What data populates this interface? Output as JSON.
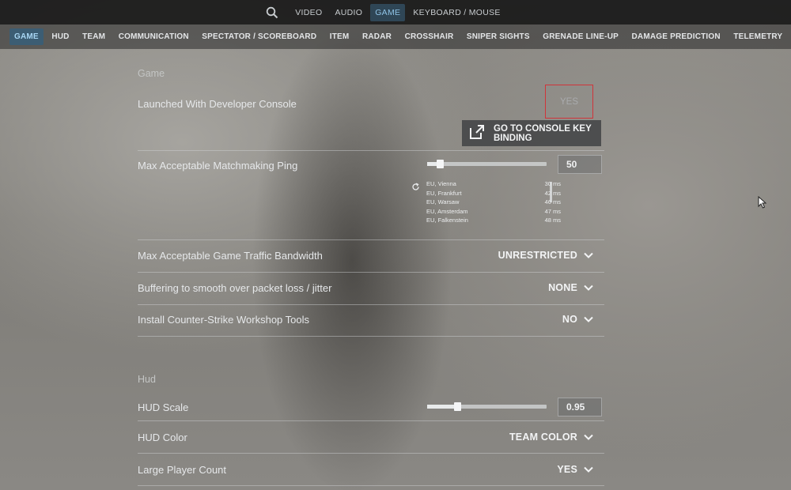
{
  "top_nav": {
    "tabs": [
      {
        "label": "VIDEO"
      },
      {
        "label": "AUDIO"
      },
      {
        "label": "GAME",
        "active": true
      },
      {
        "label": "KEYBOARD / MOUSE"
      }
    ]
  },
  "sub_nav": {
    "tabs": [
      {
        "label": "GAME",
        "active": true
      },
      {
        "label": "HUD"
      },
      {
        "label": "TEAM"
      },
      {
        "label": "COMMUNICATION"
      },
      {
        "label": "SPECTATOR / SCOREBOARD"
      },
      {
        "label": "ITEM"
      },
      {
        "label": "RADAR"
      },
      {
        "label": "CROSSHAIR"
      },
      {
        "label": "SNIPER SIGHTS"
      },
      {
        "label": "GRENADE LINE-UP"
      },
      {
        "label": "DAMAGE PREDICTION"
      },
      {
        "label": "TELEMETRY"
      }
    ]
  },
  "game_section": {
    "title": "Game",
    "dev_console": {
      "label": "Launched With Developer Console",
      "value": "YES",
      "button": "GO TO CONSOLE KEY BINDING"
    },
    "ping": {
      "label": "Max Acceptable Matchmaking Ping",
      "value": "50",
      "servers": [
        {
          "name": "EU, Vienna",
          "ping": "30 ms"
        },
        {
          "name": "EU, Frankfurt",
          "ping": "42 ms"
        },
        {
          "name": "EU, Warsaw",
          "ping": "46 ms"
        },
        {
          "name": "EU, Amsterdam",
          "ping": "47 ms"
        },
        {
          "name": "EU, Falkenstein",
          "ping": "48 ms"
        }
      ]
    },
    "bandwidth": {
      "label": "Max Acceptable Game Traffic Bandwidth",
      "value": "UNRESTRICTED"
    },
    "buffering": {
      "label": "Buffering to smooth over packet loss / jitter",
      "value": "NONE"
    },
    "workshop": {
      "label": "Install Counter-Strike Workshop Tools",
      "value": "NO"
    }
  },
  "hud_section": {
    "title": "Hud",
    "scale": {
      "label": "HUD Scale",
      "value": "0.95"
    },
    "color": {
      "label": "HUD Color",
      "value": "TEAM COLOR"
    },
    "player_count": {
      "label": "Large Player Count",
      "value": "YES"
    }
  },
  "colors": {
    "active_tab_bg": "#3c5d73",
    "active_tab_text": "#a8d6f3",
    "highlight_border": "#d0343a"
  },
  "icons": [
    "search-icon",
    "external-link-icon",
    "refresh-icon",
    "chevron-down-icon",
    "mouse-cursor-icon"
  ]
}
